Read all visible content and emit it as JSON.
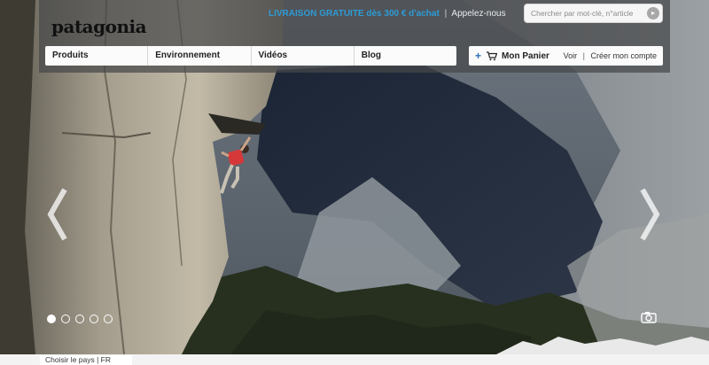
{
  "brand": {
    "logo_text": "patagonia"
  },
  "promo": {
    "highlight": "LIVRAISON GRATUITE dès 300 € d'achat",
    "separator": "|",
    "contact": "Appelez-nous"
  },
  "search": {
    "placeholder": "Chercher par mot-clé, n°article",
    "icon": "search-arrow-icon"
  },
  "nav": {
    "items": [
      {
        "label": "Produits"
      },
      {
        "label": "Environnement"
      },
      {
        "label": "Vidéos"
      },
      {
        "label": "Blog"
      }
    ]
  },
  "cart": {
    "plus": "+",
    "icon": "cart-icon",
    "label": "Mon Panier",
    "view": "Voir",
    "separator": "|",
    "create_account": "Créer mon compte"
  },
  "carousel": {
    "slide_count": 5,
    "active_slide": 1,
    "prev_icon": "chevron-left-icon",
    "next_icon": "chevron-right-icon",
    "photo_credit_icon": "camera-icon"
  },
  "footer": {
    "country_selector": "Choisir le pays | FR"
  },
  "colors": {
    "promo_highlight": "#2e9bd6",
    "cart_plus": "#2a6ebb",
    "header_band": "#46484a"
  }
}
